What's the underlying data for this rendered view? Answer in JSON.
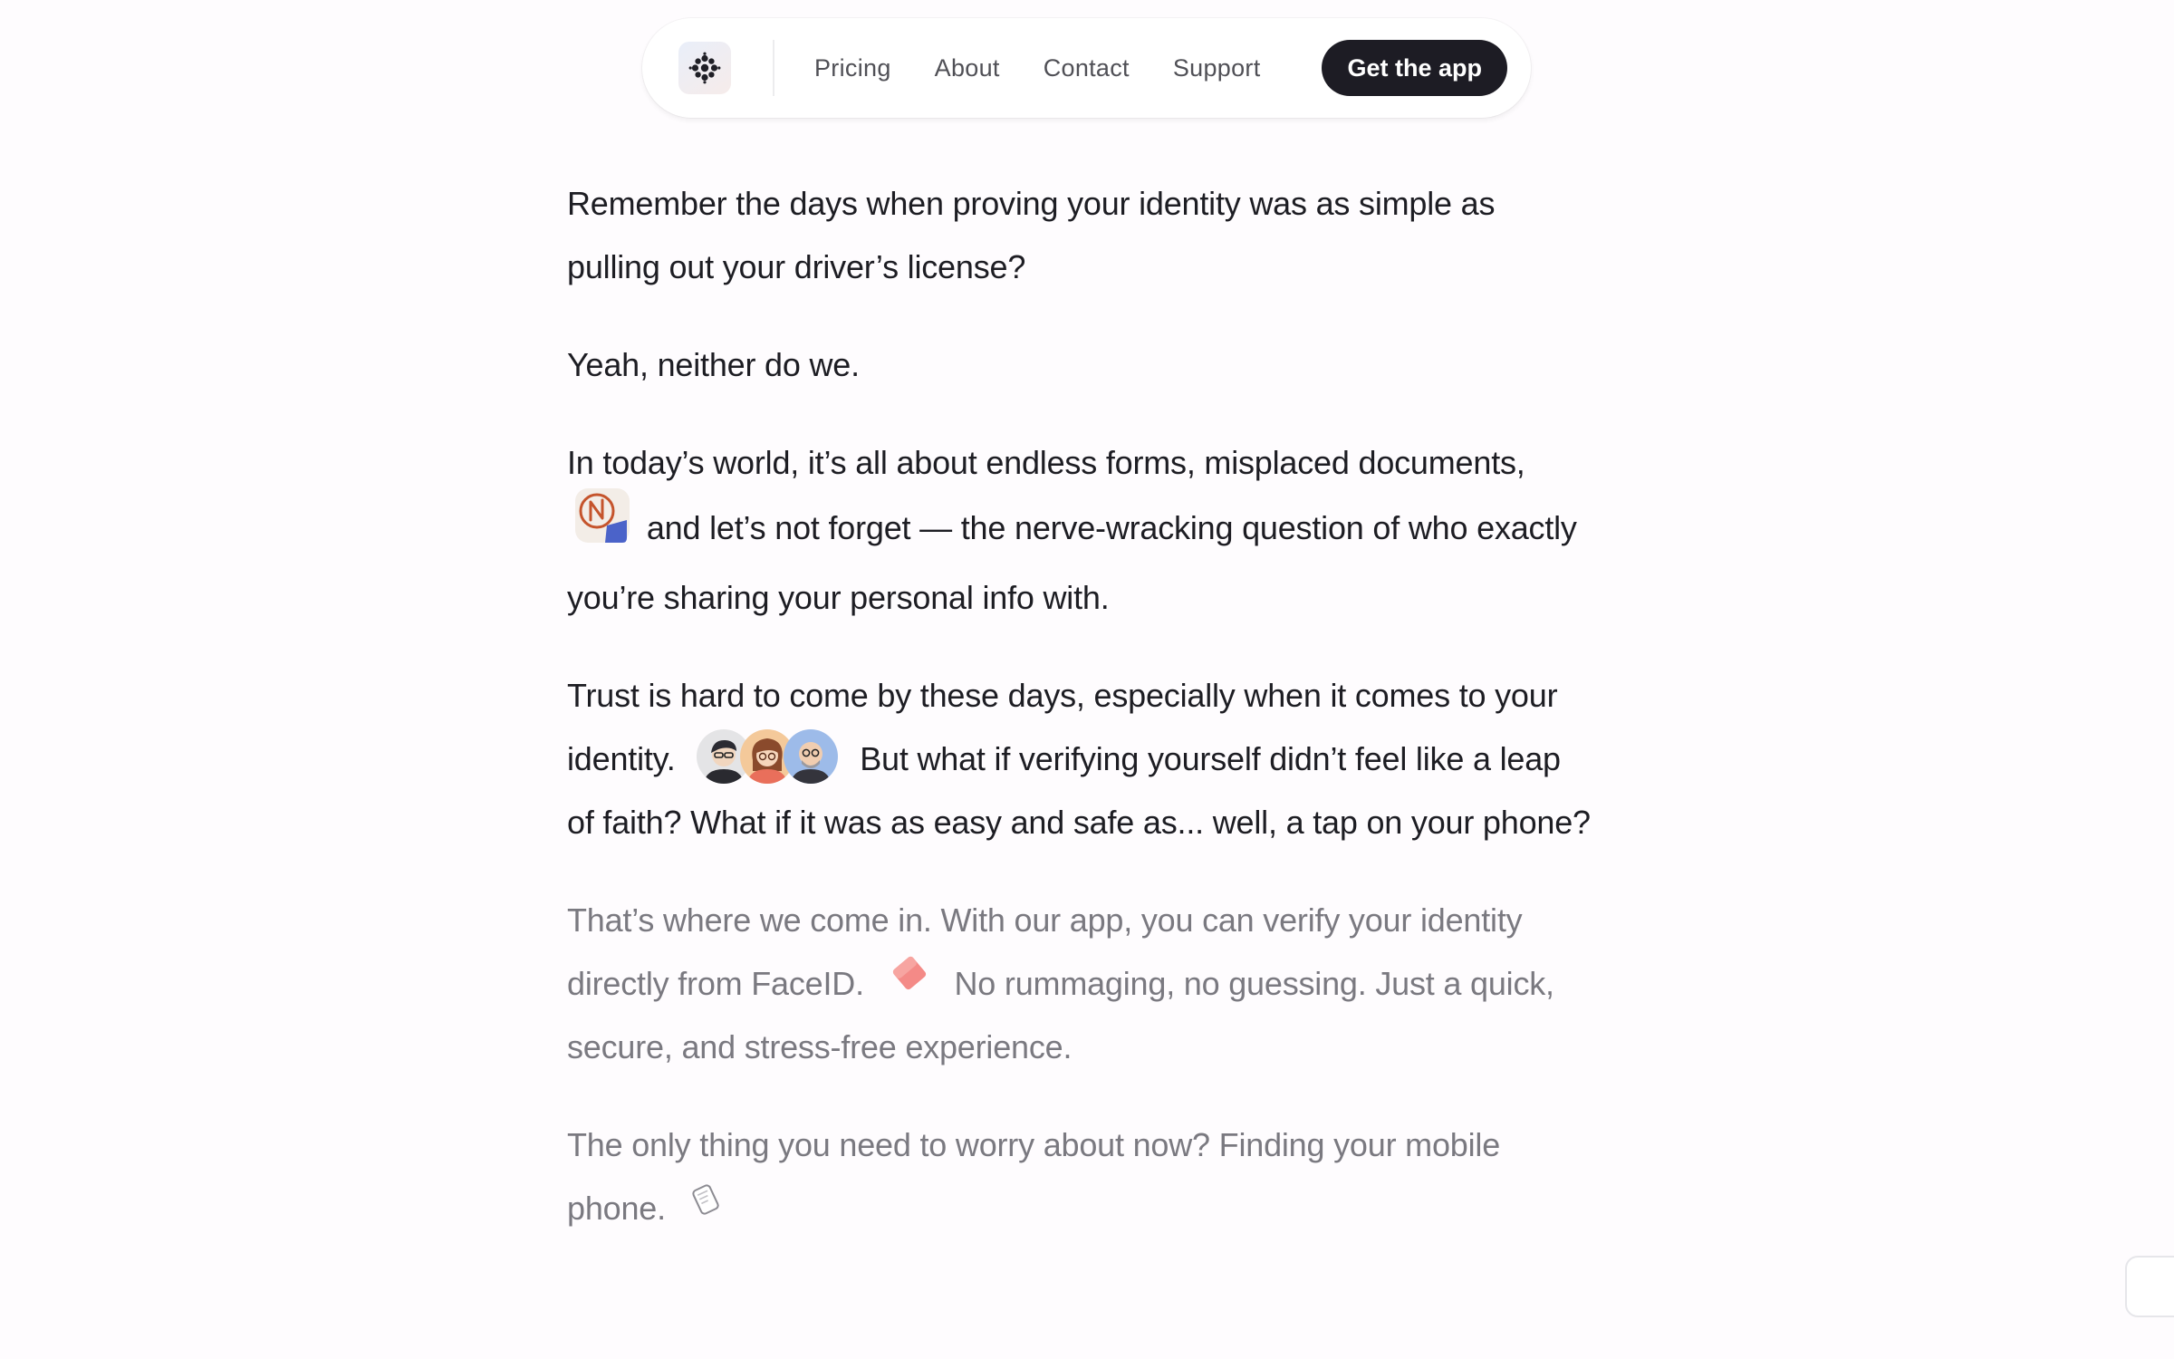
{
  "nav": {
    "links": [
      "Pricing",
      "About",
      "Contact",
      "Support"
    ],
    "cta_label": "Get the app",
    "logo_icon": "flower-logo-icon"
  },
  "article": {
    "p1": "Remember the days when proving your identity was as simple as pulling out your driver’s license?",
    "p2": "Yeah, neither do we.",
    "p3_before": "In today’s world, it’s all about endless forms, misplaced documents,",
    "p3_after": "and let’s not forget — the nerve-wracking question of who exactly you’re sharing your personal info with.",
    "p4_before": "Trust is hard to come by these days, especially when it comes to your identity.",
    "p4_after": "But what if verifying yourself didn’t feel like a leap of faith? What if it was as easy and safe as... well, a tap on your phone?",
    "p5_before": "That’s where we come in. With our app, you can verify your identity directly from FaceID.",
    "p5_after": "No rummaging, no guessing. Just a quick, secure, and stress-free experience.",
    "p6": "The only thing you need to worry about now? Finding your mobile phone."
  },
  "icons": {
    "documents_sticker": "scribble-sticker-icon",
    "avatars": [
      "avatar-man-icon",
      "avatar-woman-icon",
      "avatar-bald-man-icon"
    ],
    "faceid_sticker": "eraser-icon",
    "phone_sticker": "paper-phone-icon"
  },
  "colors": {
    "cta_bg": "#1d1c24",
    "text_dark": "#1d1d23",
    "text_muted": "#7a7980",
    "eraser": "#f48a87"
  }
}
